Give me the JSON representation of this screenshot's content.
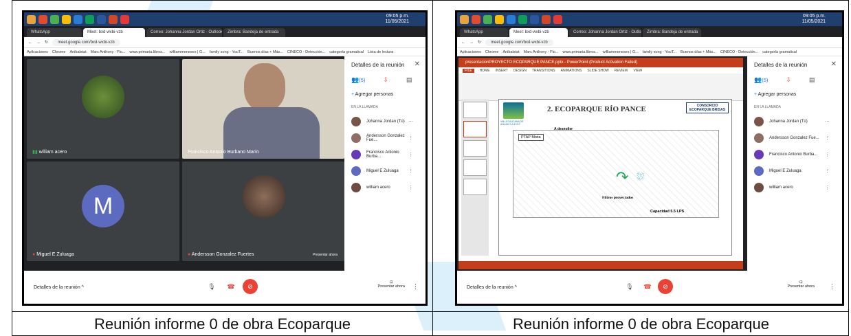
{
  "captions": {
    "left": "Reunión informe 0 de obra Ecoparque",
    "right": "Reunión informe 0 de obra Ecoparque"
  },
  "left": {
    "url": "meet.google.com/bxd-wxbi-vzb",
    "tabs": [
      "WhatsApp",
      "Meet: bxd-wxbi-vzb",
      "Correo: Johanna Jordan Ortiz - Outlook",
      "Zimbra: Bandeja de entrada"
    ],
    "bookmarks": [
      "Aplicaciones",
      "Chrome",
      "Anibalstat",
      "Marc Anthony - Flo...",
      "www.primaria.libros...",
      "williammeneses | G...",
      "family song - YouT...",
      "Buenos días + Más...",
      "CINECO - Detección...",
      "categoría gramatical",
      "Lista de lectura"
    ],
    "tiles": [
      "william acero",
      "Francisco Antonio Burbano Marín",
      "Miguel E Zuluaga",
      "Andersson Gonzalez Fuertes"
    ],
    "avatar_letter": "M",
    "panel": {
      "title": "Detalles de la reunión",
      "count": "(5)",
      "add": "Agregar personas",
      "section": "EN LA LLAMADA",
      "people": [
        "Johanna Jordan (Tú)",
        "Andersson Gonzalez Fue...",
        "Francisco Antonio Burba...",
        "Miguel E Zuluaga",
        "william acero"
      ]
    },
    "bottom": "Detalles de la reunión",
    "present": "Presentar ahora",
    "tooltip": "Presentar ahora"
  },
  "right": {
    "url": "meet.google.com/bxd-wxbi-vzb",
    "ppt_title": "presentacionPROYECTO ECOPARQUE PANCE.pptx - PowerPoint (Product Activation Failed)",
    "ppt_tabs": [
      "FILE",
      "HOME",
      "INSERT",
      "DESIGN",
      "TRANSITIONS",
      "ANIMATIONS",
      "SLIDE SHOW",
      "REVIEW",
      "VIEW"
    ],
    "slide": {
      "title": "2. ECOPARQUE RÍO PANCE",
      "brand": "CONSORCIO ECOPARQUE BRISAS",
      "logo": "VALLECAUCANA DE AGUAS S.A.E.S.P",
      "ptap": "PTAP Mixta",
      "arrow_label": "A desnoiler",
      "filters": "Filtros proyectados",
      "capacity": "Capacidad 5.5 LPS"
    },
    "panel": {
      "title": "Detalles de la reunión",
      "count": "(5)",
      "add": "Agregar personas",
      "section": "EN LA LLAMADA",
      "people": [
        "Johanna Jordan (Tú)",
        "Andersson Gonzalez Fue...",
        "Francisco Antonio Burba...",
        "Miguel E Zuluaga",
        "william acero"
      ]
    },
    "bottom": "Detalles de la reunión",
    "present": "Presentar ahora"
  },
  "clock": {
    "time": "09:05 p.m.",
    "date": "11/05/2021"
  },
  "colors": {
    "meet_bg": "#202124",
    "hangup": "#ea4335",
    "accent": "#1a73e8",
    "ppt": "#c43e1c"
  }
}
